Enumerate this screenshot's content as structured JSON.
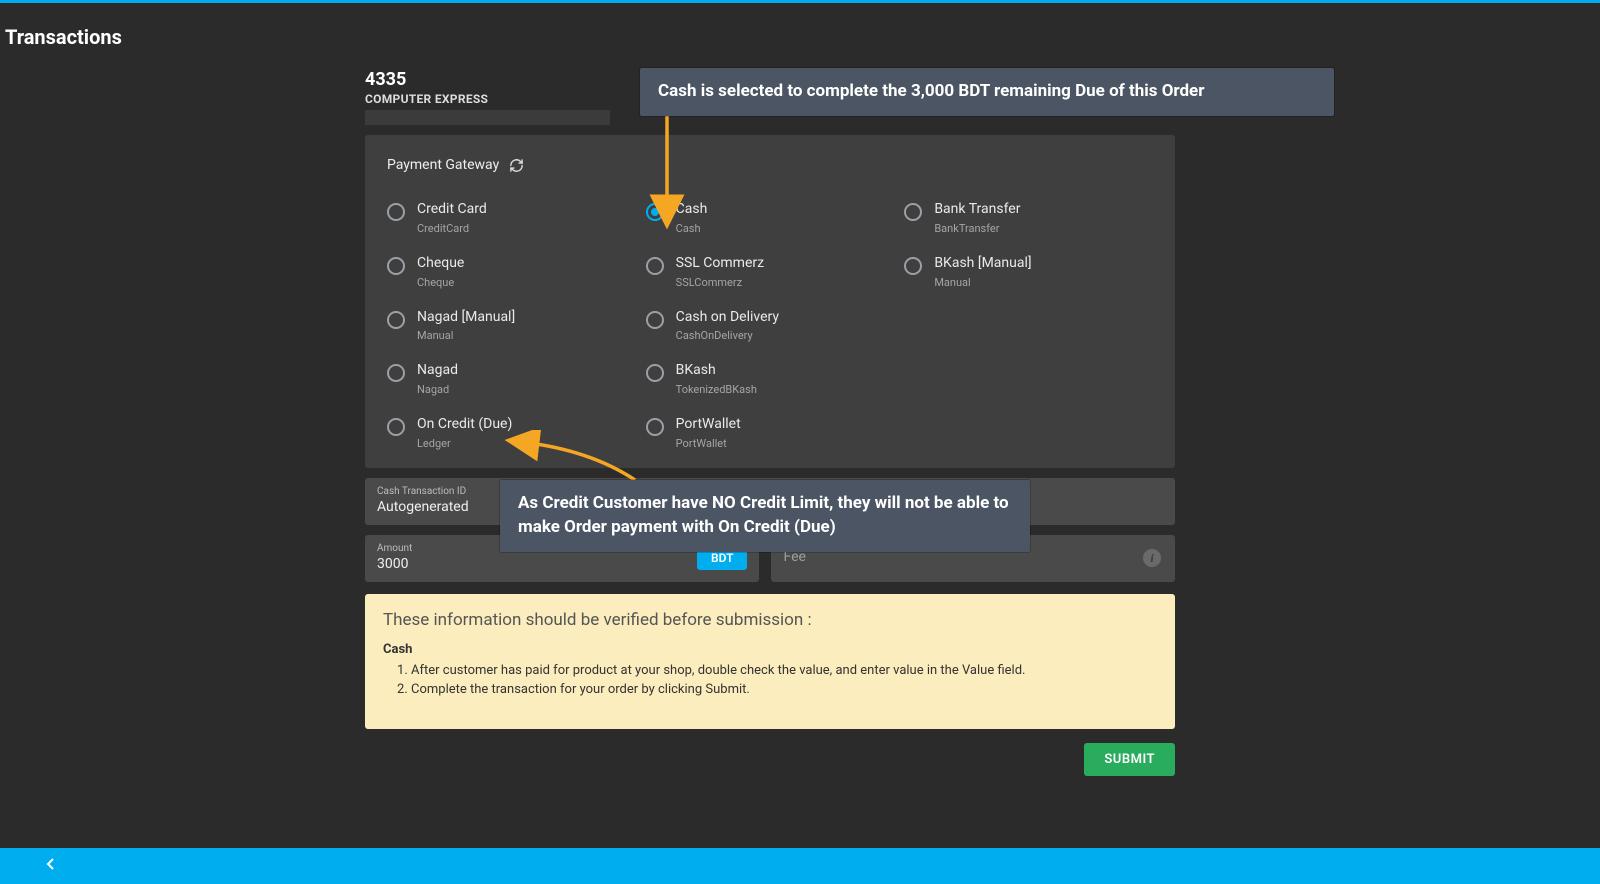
{
  "page": {
    "title": "Transactions",
    "order_id": "4335",
    "customer_name": "COMPUTER EXPRESS"
  },
  "panel": {
    "header": "Payment Gateway"
  },
  "gateways": [
    {
      "title": "Credit Card",
      "sub": "CreditCard",
      "selected": false
    },
    {
      "title": "Cash",
      "sub": "Cash",
      "selected": true
    },
    {
      "title": "Bank Transfer",
      "sub": "BankTransfer",
      "selected": false
    },
    {
      "title": "Cheque",
      "sub": "Cheque",
      "selected": false
    },
    {
      "title": "SSL Commerz",
      "sub": "SSLCommerz",
      "selected": false
    },
    {
      "title": "BKash [Manual]",
      "sub": "Manual",
      "selected": false
    },
    {
      "title": "Nagad [Manual]",
      "sub": "Manual",
      "selected": false
    },
    {
      "title": "Cash on Delivery",
      "sub": "CashOnDelivery",
      "selected": false
    },
    {
      "title": "Nagad",
      "sub": "Nagad",
      "selected": false
    },
    {
      "title": "BKash",
      "sub": "TokenizedBKash",
      "selected": false
    },
    {
      "title": "On Credit (Due)",
      "sub": "Ledger",
      "selected": false
    },
    {
      "title": "PortWallet",
      "sub": "PortWallet",
      "selected": false
    }
  ],
  "gateway_col_placement": [
    0,
    1,
    2,
    0,
    1,
    2,
    0,
    1,
    0,
    1,
    0,
    1
  ],
  "transaction_id": {
    "label": "Cash Transaction ID",
    "value": "Autogenerated"
  },
  "amount": {
    "label": "Amount",
    "value": "3000",
    "currency": "BDT"
  },
  "fee": {
    "placeholder": "Fee"
  },
  "verify": {
    "title": "These information should be verified before submission :",
    "subtitle": "Cash",
    "step1": "After customer has paid for product at your shop, double check the value, and enter value in the Value field.",
    "step2": "Complete the transaction for your order by clicking Submit."
  },
  "submit_label": "SUBMIT",
  "annotations": {
    "a1": "Cash is selected to complete the 3,000 BDT remaining Due of this Order",
    "a2": "As Credit Customer have NO Credit Limit, they will not be able to make Order payment with On Credit (Due)"
  }
}
